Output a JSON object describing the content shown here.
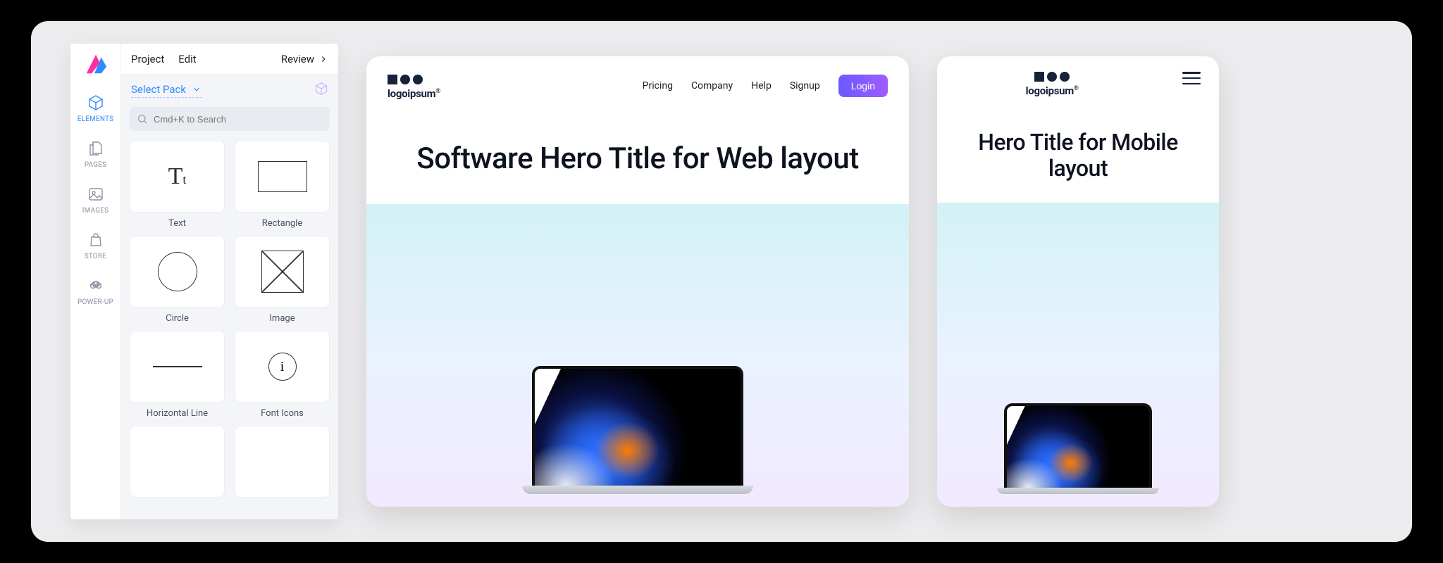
{
  "menubar": {
    "project": "Project",
    "edit": "Edit",
    "review": "Review"
  },
  "rail": {
    "elements": "ELEMENTS",
    "pages": "PAGES",
    "images": "IMAGES",
    "store": "STORE",
    "powerup": "POWER-UP"
  },
  "panel": {
    "select_pack": "Select Pack",
    "search_placeholder": "Cmd+K to Search"
  },
  "elements": {
    "text": "Text",
    "rectangle": "Rectangle",
    "circle": "Circle",
    "image": "Image",
    "hline": "Horizontal Line",
    "fonticons": "Font Icons"
  },
  "logo": {
    "word": "logoipsum"
  },
  "web": {
    "nav": {
      "pricing": "Pricing",
      "company": "Company",
      "help": "Help",
      "signup": "Signup",
      "login": "Login"
    },
    "hero_title": "Software Hero Title for Web layout"
  },
  "mobile": {
    "hero_title": "Hero Title for Mobile layout"
  }
}
